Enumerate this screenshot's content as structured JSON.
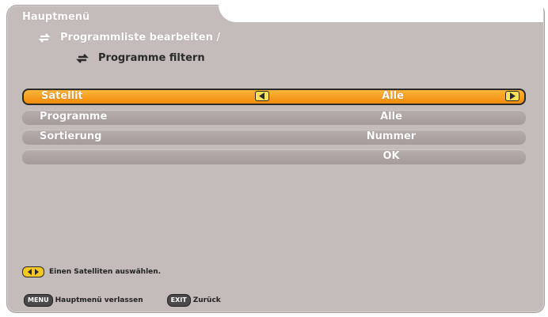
{
  "header": {
    "title": "Hauptmenü"
  },
  "breadcrumb": {
    "level1": "Programmliste bearbeiten /",
    "level2": "Programme filtern"
  },
  "settings": [
    {
      "label": "Satellit",
      "value": "Alle",
      "selected": true
    },
    {
      "label": "Programme",
      "value": "Alle",
      "selected": false
    },
    {
      "label": "Sortierung",
      "value": "Nummer",
      "selected": false
    },
    {
      "label": "",
      "value": "OK",
      "selected": false
    }
  ],
  "hint": {
    "text": "Einen Satelliten auswählen."
  },
  "footer": {
    "menu_key": "MENU",
    "menu_label": "Hauptmenü verlassen",
    "exit_key": "EXIT",
    "exit_label": "Zurück"
  },
  "colors": {
    "panel": "#c4bcba",
    "row": "#aaa19f",
    "selected": "#f5a020",
    "arrow_button": "#f9e25a"
  },
  "icons": {
    "breadcrumb": "swap-icon",
    "left": "arrow-left-icon",
    "right": "arrow-right-icon",
    "hint": "left-right-icon"
  }
}
